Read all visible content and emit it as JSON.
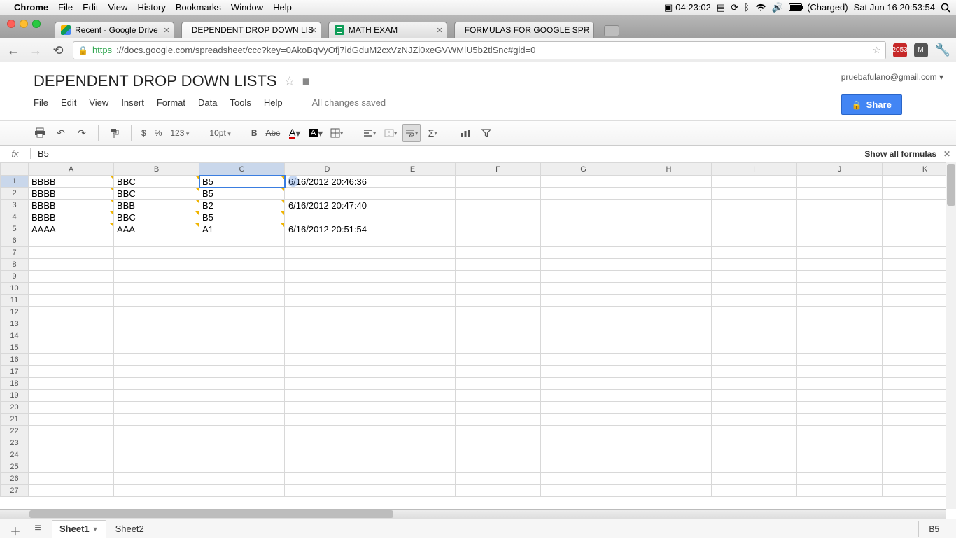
{
  "mac_menu": {
    "app": "Chrome",
    "items": [
      "File",
      "Edit",
      "View",
      "History",
      "Bookmarks",
      "Window",
      "Help"
    ],
    "timer": "04:23:02",
    "battery": "(Charged)",
    "datetime": "Sat Jun 16  20:53:54"
  },
  "tabs": [
    {
      "label": "Recent - Google Drive",
      "fav": "drive"
    },
    {
      "label": "DEPENDENT DROP DOWN LIS",
      "fav": "sheet",
      "active": true
    },
    {
      "label": "MATH EXAM",
      "fav": "sheet"
    },
    {
      "label": "FORMULAS FOR GOOGLE SPR",
      "fav": "doc"
    }
  ],
  "url": {
    "proto": "https",
    "rest": "://docs.google.com/spreadsheet/ccc?key=0AkoBqVyOfj7idGduM2cxVzNJZi0xeGVWMlU5b2tlSnc#gid=0"
  },
  "ext_badge": "2053",
  "doc": {
    "title": "DEPENDENT DROP DOWN LISTS",
    "menus": [
      "File",
      "Edit",
      "View",
      "Insert",
      "Format",
      "Data",
      "Tools",
      "Help"
    ],
    "save_status": "All changes saved",
    "user_email": "pruebafulano@gmail.com",
    "share_label": "Share"
  },
  "toolbar": {
    "dollar": "$",
    "percent": "%",
    "num_fmt": "123",
    "font_size": "10pt",
    "bold": "B",
    "strike": "Abc",
    "sigma": "Σ"
  },
  "formula_bar": {
    "fx": "fx",
    "value": "B5",
    "show_all": "Show all formulas"
  },
  "columns": [
    "A",
    "B",
    "C",
    "D",
    "E",
    "F",
    "G",
    "H",
    "I",
    "J",
    "K"
  ],
  "row_count": 27,
  "active_col": "C",
  "active_row": 1,
  "rows": [
    {
      "A": "BBBB",
      "B": "BBC",
      "C": "B5",
      "D": "6/16/2012 20:46:36",
      "dv": [
        "A",
        "B",
        "C"
      ]
    },
    {
      "A": "BBBB",
      "B": "BBC",
      "C": "B5",
      "D": "",
      "dv": [
        "A",
        "B",
        "C"
      ]
    },
    {
      "A": "BBBB",
      "B": "BBB",
      "C": "B2",
      "D": "6/16/2012 20:47:40",
      "dv": [
        "A",
        "B",
        "C"
      ]
    },
    {
      "A": "BBBB",
      "B": "BBC",
      "C": "B5",
      "D": "",
      "dv": [
        "A",
        "B",
        "C"
      ]
    },
    {
      "A": "AAAA",
      "B": "AAA",
      "C": "A1",
      "D": "6/16/2012 20:51:54",
      "dv": [
        "A",
        "B",
        "C"
      ]
    }
  ],
  "sheet_tabs": [
    "Sheet1",
    "Sheet2"
  ],
  "active_sheet": 0,
  "quicksum": "B5"
}
